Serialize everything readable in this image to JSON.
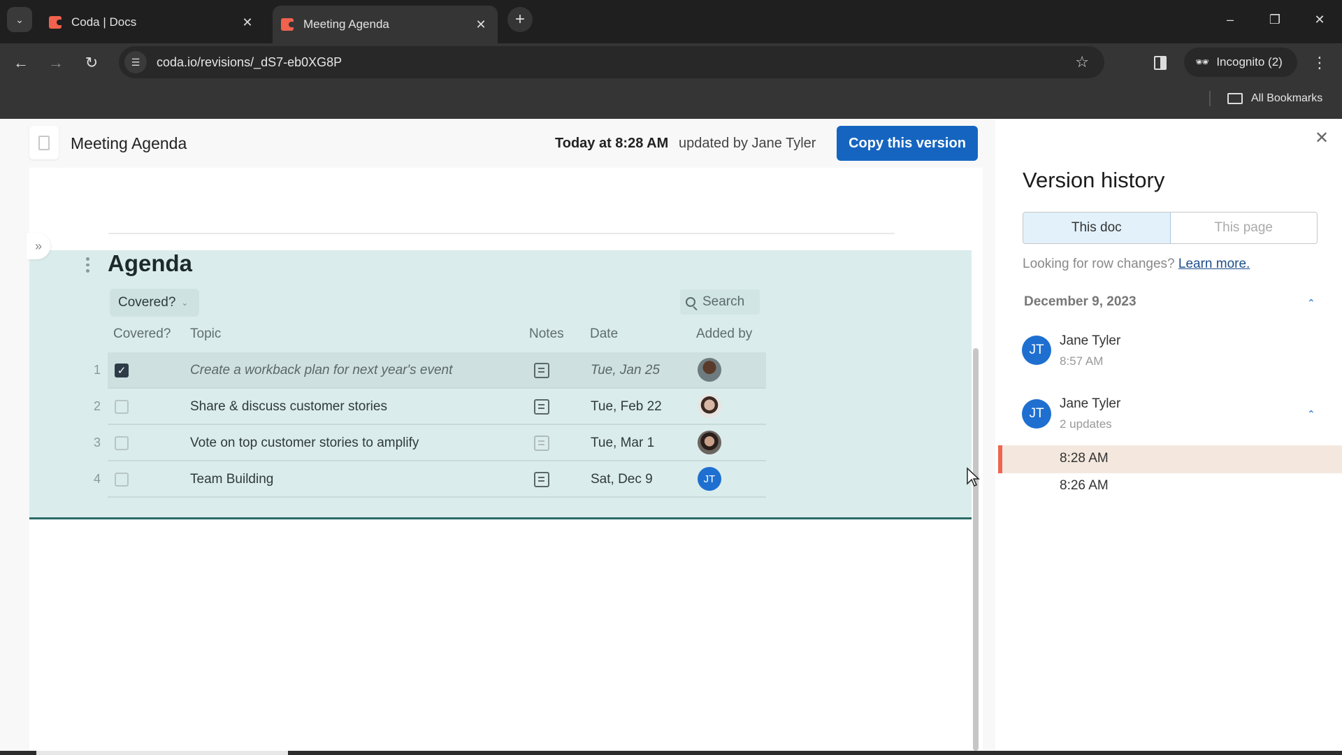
{
  "browser": {
    "tabs": [
      {
        "title": "Coda | Docs",
        "active": false
      },
      {
        "title": "Meeting Agenda",
        "active": true
      }
    ],
    "url": "coda.io/revisions/_dS7-eb0XG8P",
    "profile_label": "Incognito (2)",
    "bookmarks_label": "All Bookmarks",
    "icons": {
      "tab_list": "chevron-down-icon",
      "new_tab": "plus-icon",
      "back": "arrow-left-icon",
      "forward": "arrow-right-icon",
      "reload": "reload-icon",
      "site_info": "tune-icon",
      "bookmark": "star-icon",
      "side_panel": "side-panel-icon",
      "menu": "kebab-icon"
    }
  },
  "doc_header": {
    "title": "Meeting Agenda",
    "updated_time": "Today at 8:28 AM",
    "updated_by": "updated by Jane Tyler",
    "copy_button": "Copy this version"
  },
  "agenda": {
    "title": "Agenda",
    "filter_chip": "Covered?",
    "search_label": "Search",
    "columns": [
      "Covered?",
      "Topic",
      "Notes",
      "Date",
      "Added by"
    ],
    "rows": [
      {
        "num": "1",
        "covered": true,
        "topic": "Create a workback plan for next year's event",
        "notes_icon": "notes-icon",
        "date": "Tue, Jan 25",
        "added_by": "avatar-photo-1",
        "italic": true
      },
      {
        "num": "2",
        "covered": false,
        "topic": "Share & discuss customer stories",
        "notes_icon": "notes-icon",
        "date": "Tue, Feb 22",
        "added_by": "avatar-photo-2",
        "italic": false
      },
      {
        "num": "3",
        "covered": false,
        "topic": "Vote on top customer stories to amplify",
        "notes_icon": "notes-icon-empty",
        "date": "Tue, Mar 1",
        "added_by": "avatar-photo-3",
        "italic": false
      },
      {
        "num": "4",
        "covered": false,
        "topic": "Team Building",
        "notes_icon": "notes-icon",
        "date": "Sat, Dec 9",
        "added_by": "JT",
        "italic": false
      }
    ]
  },
  "version_history": {
    "title": "Version history",
    "scope_options": [
      "This doc",
      "This page"
    ],
    "scope_selected": "This doc",
    "row_changes_text": "Looking for row changes?",
    "learn_more": "Learn more.",
    "date_group": "December 9, 2023",
    "entries": [
      {
        "initials": "JT",
        "name": "Jane Tyler",
        "sub": "8:57 AM"
      },
      {
        "initials": "JT",
        "name": "Jane Tyler",
        "sub": "2 updates",
        "expanded": true,
        "versions": [
          {
            "time": "8:28 AM",
            "selected": true
          },
          {
            "time": "8:26 AM",
            "selected": false
          }
        ]
      }
    ]
  },
  "colors": {
    "accent_blue": "#1565c0",
    "avatar_blue": "#1e6fd0",
    "selected_marker": "#ee6553",
    "agenda_bg": "#dbecec",
    "coda_brand": "#f0624d"
  }
}
